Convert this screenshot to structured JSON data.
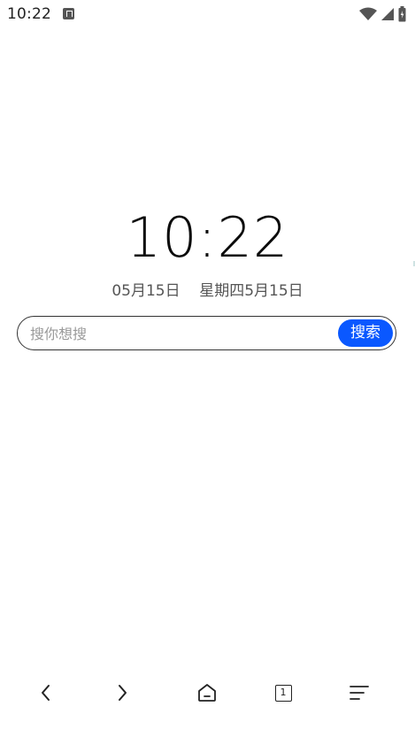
{
  "status_bar": {
    "time": "10:22",
    "app_badge_icon": "accessibility-a-icon",
    "wifi_icon": "wifi-icon",
    "signal_icon": "cell-signal-icon",
    "battery_icon": "battery-icon"
  },
  "home": {
    "clock": "10:22",
    "date_line": "05月15日    星期四5月15日"
  },
  "search": {
    "placeholder": "搜你想搜",
    "value": "",
    "button_label": "搜索",
    "accent_color": "#0a58ff"
  },
  "bottom_nav": {
    "back_icon": "chevron-left-icon",
    "forward_icon": "chevron-right-icon",
    "home_icon": "home-icon",
    "tabs_count": "1",
    "menu_icon": "menu-icon"
  }
}
